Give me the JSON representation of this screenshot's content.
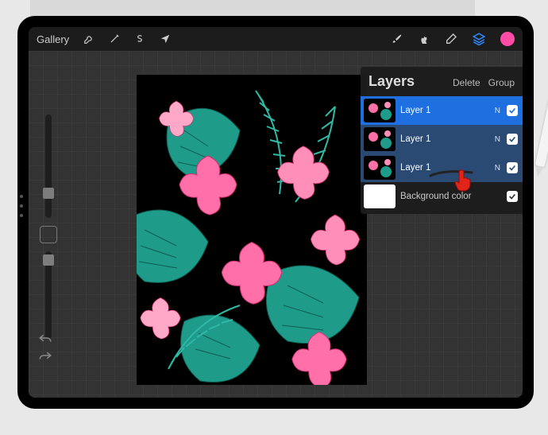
{
  "toolbar": {
    "gallery_label": "Gallery"
  },
  "layers_panel": {
    "title": "Layers",
    "delete_label": "Delete",
    "group_label": "Group",
    "layers": [
      {
        "name": "Layer 1",
        "blend": "N",
        "visible": true,
        "selected": "primary"
      },
      {
        "name": "Layer 1",
        "blend": "N",
        "visible": true,
        "selected": "secondary"
      },
      {
        "name": "Layer 1",
        "blend": "N",
        "visible": true,
        "selected": "secondary"
      },
      {
        "name": "Background color",
        "blend": "",
        "visible": true,
        "selected": "none",
        "is_bg": true
      }
    ]
  },
  "colors": {
    "brush_color": "#ff4da6",
    "layers_active": "#2f8bff"
  }
}
